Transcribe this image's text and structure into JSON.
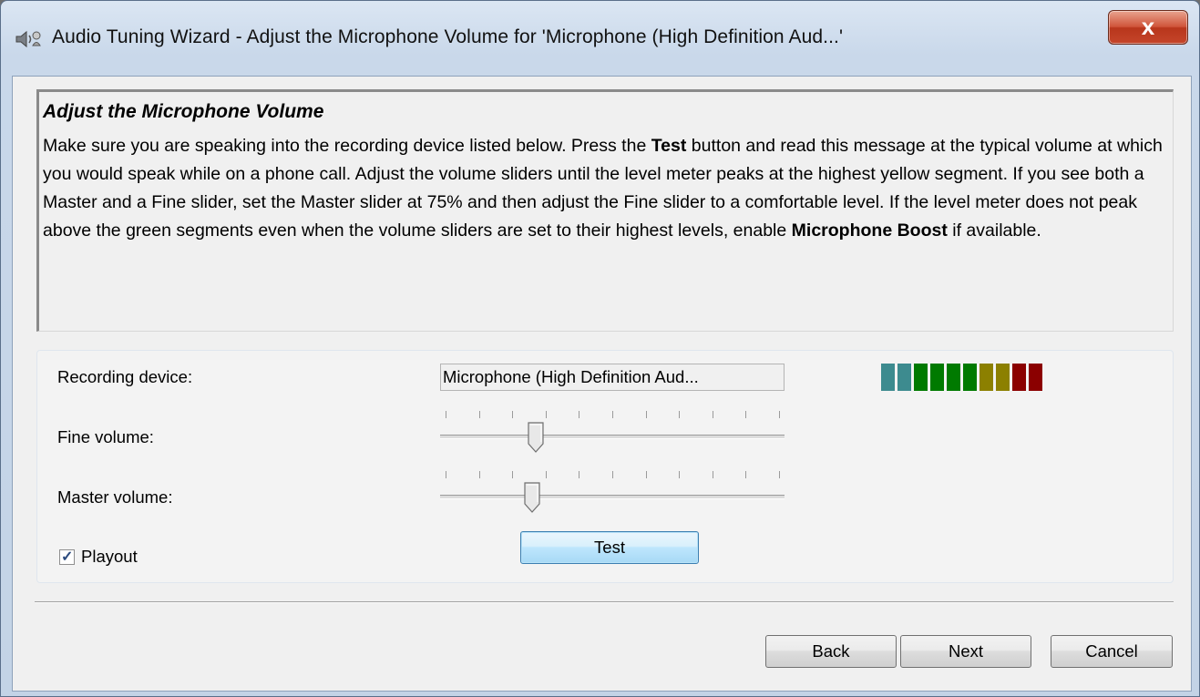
{
  "window": {
    "title": "Audio Tuning Wizard - Adjust the Microphone Volume for 'Microphone (High Definition Aud...'",
    "close_label": "x"
  },
  "info": {
    "heading": "Adjust the Microphone Volume",
    "body_parts": [
      "Make sure you are speaking into the recording device listed below. Press the ",
      "Test",
      " button and read this message at the typical volume at which you would speak while on a phone call. Adjust the volume sliders until the level meter peaks at the highest yellow segment. If you see both a Master and a Fine slider, set the Master slider at 75% and then adjust the Fine slider to a comfortable level. If the level meter does not peak above the green segments even when the volume sliders are set to their highest levels, enable ",
      "Microphone Boost",
      " if available."
    ]
  },
  "settings": {
    "recording_device_label": "Recording device:",
    "recording_device_value": "Microphone (High Definition Aud...",
    "fine_volume_label": "Fine volume:",
    "fine_volume_level": 0.27,
    "master_volume_label": "Master volume:",
    "master_volume_level": 0.26,
    "slider_tick_count": 11,
    "playout_label": "Playout",
    "playout_checked": true,
    "test_label": "Test",
    "level_meter": {
      "segments": [
        "#3d8b8f",
        "#3d8b8f",
        "#007a00",
        "#007a00",
        "#007a00",
        "#007a00",
        "#8c8000",
        "#8c8000",
        "#8b0000",
        "#8b0000"
      ]
    }
  },
  "footer": {
    "back_label": "Back",
    "next_label": "Next",
    "cancel_label": "Cancel"
  },
  "colors": {
    "title_gradient_top": "#dbe6f3",
    "close_button_red": "#c5452a",
    "focus_blue": "#3c7fb1"
  }
}
